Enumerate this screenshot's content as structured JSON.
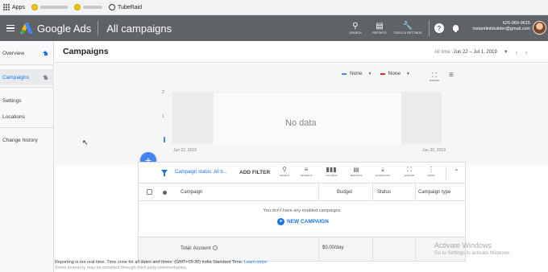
{
  "browser": {
    "bookmarks": [
      {
        "label": "Apps"
      },
      {
        "label": ""
      },
      {
        "label": ""
      },
      {
        "label": "TubeRaid"
      }
    ]
  },
  "header": {
    "product": "Google Ads",
    "page_title": "All campaigns",
    "tools": [
      {
        "label": "SEARCH",
        "icon": "search-icon"
      },
      {
        "label": "REPORTS",
        "icon": "reports-icon"
      },
      {
        "label": "TOOLS & SETTINGS",
        "icon": "wrench-icon"
      }
    ],
    "account_id": "626-069-9615",
    "account_email": "instantlinkbuilder@gmail.com"
  },
  "sidebar": {
    "items": [
      {
        "label": "Overview"
      },
      {
        "label": "Campaigns"
      },
      {
        "label": "Settings"
      },
      {
        "label": "Locations"
      },
      {
        "label": "Change history"
      }
    ]
  },
  "toolbar": {
    "title": "Campaigns",
    "date_prefix": "All time",
    "date_range": "Jun 22 – Jul 1, 2019"
  },
  "chart": {
    "metric1": "None",
    "metric2": "None",
    "expand_label": "EXPAND",
    "no_data": "No data",
    "x_start": "Jun 22, 2019",
    "x_end": "Jun 30, 2019",
    "y_ticks": [
      "2",
      "1"
    ],
    "metric1_color": "#4285f4",
    "metric2_color": "#d93025"
  },
  "chart_data": {
    "type": "line",
    "title": "",
    "x": [
      "Jun 22, 2019",
      "Jun 30, 2019"
    ],
    "series": [],
    "y_ticks": [
      1,
      2
    ],
    "xlabel": "",
    "ylabel": "",
    "grid": false
  },
  "table": {
    "status_filter": "Campaign status: All b...",
    "add_filter": "ADD FILTER",
    "tools": [
      {
        "label": "SEARCH",
        "icon": "search-icon"
      },
      {
        "label": "SEGMENT",
        "icon": "segment-icon"
      },
      {
        "label": "COLUMNS",
        "icon": "columns-icon"
      },
      {
        "label": "REPORTS",
        "icon": "reports-icon"
      },
      {
        "label": "DOWNLOAD",
        "icon": "download-icon"
      },
      {
        "label": "EXPAND",
        "icon": "expand-icon"
      },
      {
        "label": "MORE",
        "icon": "more-icon"
      }
    ],
    "columns": [
      "Campaign",
      "Budget",
      "Status",
      "Campaign type"
    ],
    "empty_message": "You don't have any enabled campaigns",
    "new_campaign": "NEW CAMPAIGN",
    "total_label": "Total: Account",
    "total_budget": "$0.00/day"
  },
  "footer": {
    "line1": "Reporting is not real-time. Time zone for all dates and times: (GMT+05:30) India Standard Time.",
    "learn_more": "Learn more",
    "line2": "Some inventory may be provided through third party intermediaries."
  },
  "overlay": {
    "activate_title": "Activate Windows",
    "activate_sub": "Go to Settings to activate Windows."
  }
}
